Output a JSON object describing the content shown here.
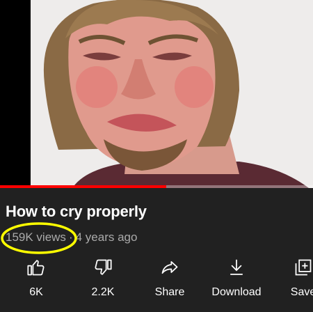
{
  "video": {
    "title": "How to cry properly",
    "views": "159K views",
    "separator": "·",
    "age": "4 years ago",
    "progress_fraction": 0.53
  },
  "actions": [
    {
      "label": "6K",
      "icon": "thumbs-up-icon"
    },
    {
      "label": "2.2K",
      "icon": "thumbs-down-icon"
    },
    {
      "label": "Share",
      "icon": "share-icon"
    },
    {
      "label": "Download",
      "icon": "download-icon"
    },
    {
      "label": "Save",
      "icon": "save-to-playlist-icon"
    }
  ],
  "colors": {
    "background": "#212121",
    "progress": "#ff0000",
    "highlight": "#ffff00",
    "secondary_text": "#aaaaaa"
  }
}
